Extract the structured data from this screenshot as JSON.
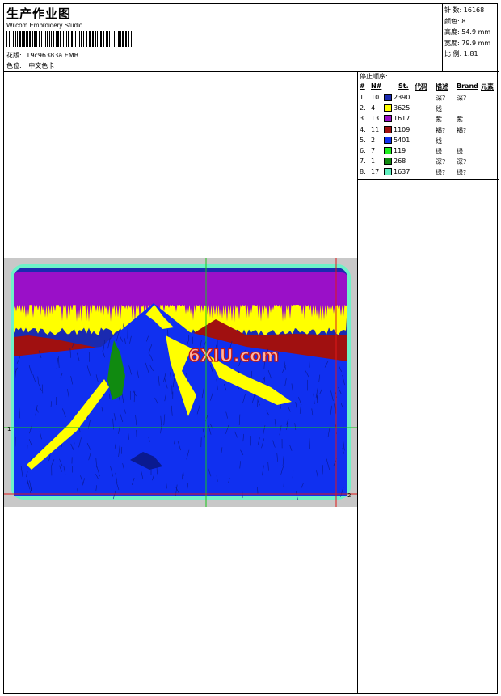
{
  "header": {
    "title": "生产作业图",
    "software": "Wilcom Embroidery Studio",
    "design_label": "花版:",
    "design_name": "19c96383a.EMB",
    "color_label": "色位:",
    "color_chart": "中文色卡"
  },
  "specs": [
    "针 数: 16168",
    "颜色: 8",
    "高度: 54.9 mm",
    "宽度: 79.9 mm",
    "比 例: 1.81"
  ],
  "stop_sequence": {
    "title": "停止顺序:",
    "columns": [
      "#",
      "N#",
      "St.",
      "代码",
      "描述",
      "Brand",
      "元素"
    ],
    "rows": [
      {
        "idx": "1.",
        "n": "10",
        "color": "#1a2ab0",
        "st": "2390",
        "code": "",
        "desc": "深?",
        "brand": "深?"
      },
      {
        "idx": "2.",
        "n": "4",
        "color": "#ffff00",
        "st": "3625",
        "code": "",
        "desc": "线",
        "brand": ""
      },
      {
        "idx": "3.",
        "n": "13",
        "color": "#9a10c8",
        "st": "1617",
        "code": "",
        "desc": "紫",
        "brand": "紫"
      },
      {
        "idx": "4.",
        "n": "11",
        "color": "#a01010",
        "st": "1109",
        "code": "",
        "desc": "褐?",
        "brand": "褐?"
      },
      {
        "idx": "5.",
        "n": "2",
        "color": "#1030f0",
        "st": "5401",
        "code": "",
        "desc": "线",
        "brand": ""
      },
      {
        "idx": "6.",
        "n": "7",
        "color": "#20f020",
        "st": "119",
        "code": "",
        "desc": "绿",
        "brand": "绿"
      },
      {
        "idx": "7.",
        "n": "1",
        "color": "#108a10",
        "st": "268",
        "code": "",
        "desc": "深?",
        "brand": "深?"
      },
      {
        "idx": "8.",
        "n": "17",
        "color": "#60f0c0",
        "st": "1637",
        "code": "",
        "desc": "绿?",
        "brand": "绿?"
      }
    ]
  },
  "preview": {
    "watermark": "6XIU.com",
    "marker_start": "1",
    "marker_end": "2"
  }
}
